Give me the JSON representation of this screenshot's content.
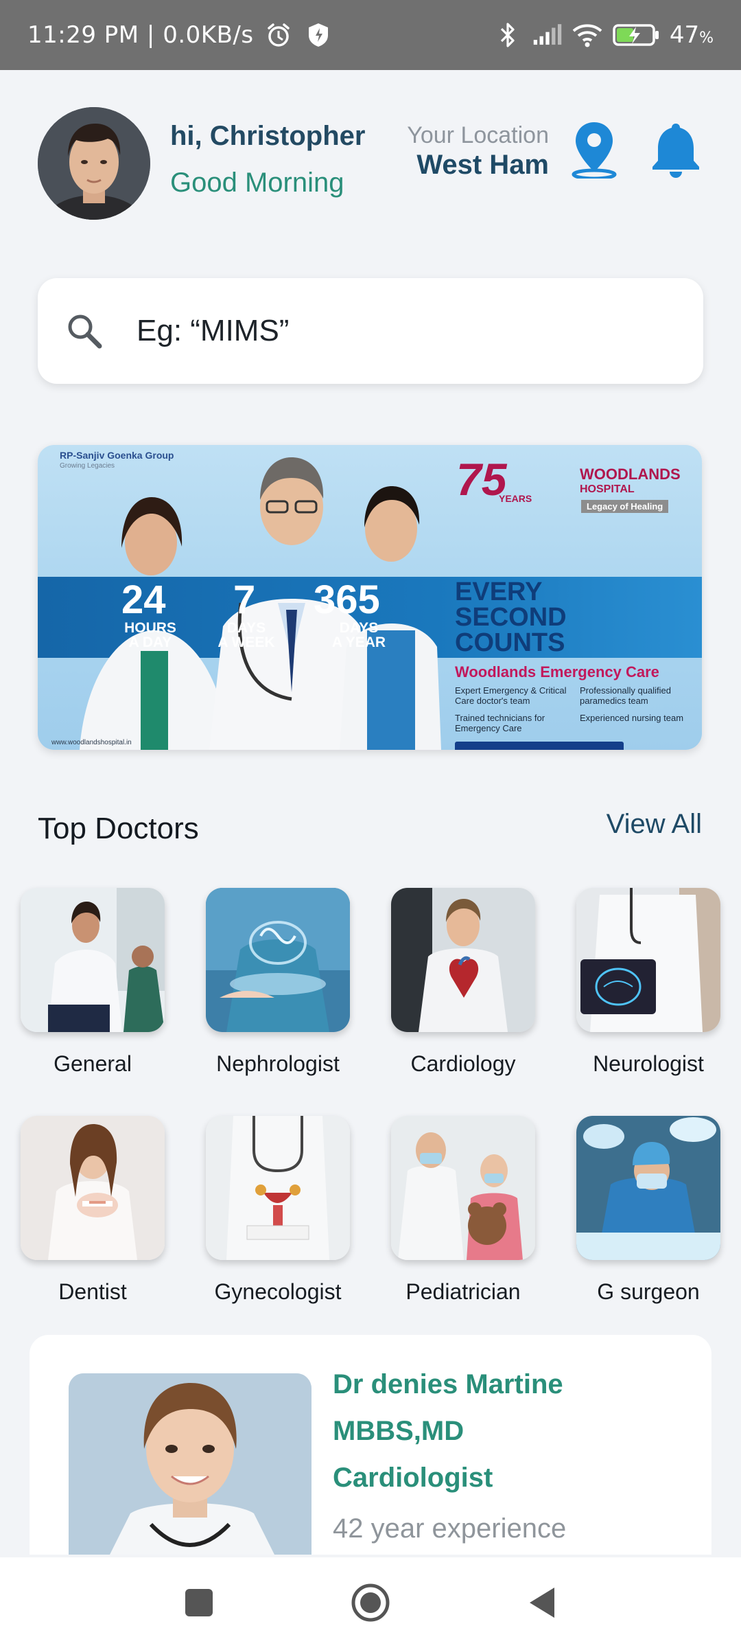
{
  "status_bar": {
    "time": "11:29 PM | 0.0KB/s",
    "battery": "47",
    "battery_unit": "%",
    "icons": [
      "alarm-icon",
      "shield-icon",
      "bluetooth-icon",
      "signal-icon",
      "wifi-icon",
      "battery-charging-icon"
    ]
  },
  "header": {
    "greeting": "hi, Christopher",
    "subtitle": "Good Morning",
    "location_label": "Your Location",
    "location_value": "West Ham"
  },
  "search": {
    "placeholder": "Eg: “MIMS”"
  },
  "banner": {
    "brand": "RP-Sanjiv Goenka Group",
    "brand_tag": "Growing Legacies",
    "years": "75",
    "years_label": "YEARS",
    "hospital_name": "WOODLANDS",
    "hospital_word": "HOSPITAL",
    "legacy": "Legacy of Healing",
    "stats": [
      {
        "num": "24",
        "label1": "HOURS",
        "label2": "A DAY"
      },
      {
        "num": "7",
        "label1": "DAYS",
        "label2": "A WEEK"
      },
      {
        "num": "365",
        "label1": "DAYS",
        "label2": "A YEAR"
      }
    ],
    "headline1": "EVERY",
    "headline2": "SECOND",
    "headline3": "COUNTS",
    "emergency_title": "Woodlands Emergency Care",
    "bullets": [
      "Expert Emergency & Critical Care doctor's team",
      "Professionally qualified paramedics team",
      "Trained technicians for Emergency Care",
      "Experienced nursing team"
    ],
    "website": "www.woodlandshospital.in"
  },
  "top_doctors": {
    "title": "Top Doctors",
    "view_all": "View All",
    "categories": [
      {
        "label": "General"
      },
      {
        "label": "Nephrologist"
      },
      {
        "label": "Cardiology"
      },
      {
        "label": "Neurologist"
      },
      {
        "label": "Dentist"
      },
      {
        "label": "Gynecologist"
      },
      {
        "label": "Pediatrician"
      },
      {
        "label": "G surgeon"
      }
    ]
  },
  "doctor_card": {
    "name": "Dr denies Martine",
    "degree": "MBBS,MD",
    "specialty": "Cardiologist",
    "experience": "42 year experience"
  },
  "colors": {
    "accent_blue": "#1f4a66",
    "accent_green": "#2a8f7a",
    "icon_blue": "#1e88d6"
  }
}
